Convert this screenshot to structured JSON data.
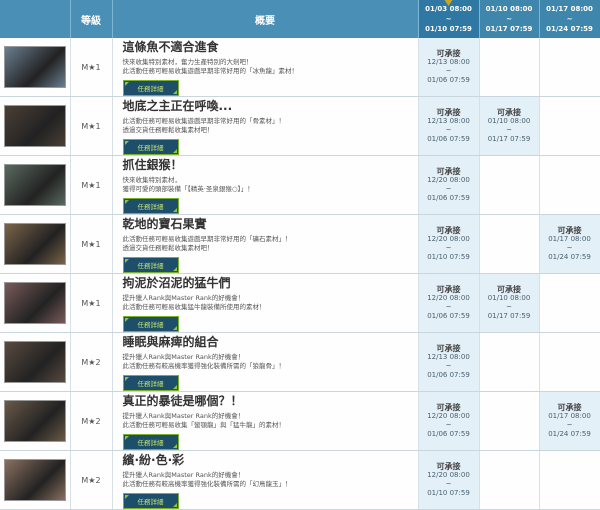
{
  "header": {
    "rank": "等級",
    "summary": "概要",
    "weeks": [
      {
        "start": "01/03 08:00",
        "sep": "~",
        "end": "01/10 07:59",
        "current": true
      },
      {
        "start": "01/10 08:00",
        "sep": "~",
        "end": "01/17 07:59"
      },
      {
        "start": "01/17 08:00",
        "sep": "~",
        "end": "01/24 07:59"
      }
    ]
  },
  "detail_label": "任務詳細",
  "available_label": "可承接",
  "quests": [
    {
      "thumb": "#6a7f90",
      "rank": "M★1",
      "title": "這條魚不適合進食",
      "desc": [
        "快來收集特別素材，奮力生產特別的大劍吧！",
        "此活動任務可輕易收集遊戲早期非常好用的「冰魚龍」素材！"
      ],
      "slots": [
        [
          "12/13 08:00",
          "01/06 07:59"
        ],
        null,
        null
      ]
    },
    {
      "thumb": "#4a3f35",
      "rank": "M★1",
      "title": "地底之主正在呼喚...",
      "desc": [
        "此活動任務可輕易收集遊戲早期非常好用的「骨素材」！",
        "透過交貨任務輕鬆收集素材吧！"
      ],
      "slots": [
        [
          "12/13 08:00",
          "01/06 07:59"
        ],
        [
          "01/10 08:00",
          "01/17 07:59"
        ],
        null
      ]
    },
    {
      "thumb": "#5a6a60",
      "rank": "M★1",
      "title": "抓住銀猴！",
      "desc": [
        "快來收集特別素材，",
        "獲得可愛的頭部裝備「【精英·圣泉銀猴○】」！"
      ],
      "slots": [
        [
          "12/20 08:00",
          "01/06 07:59"
        ],
        null,
        null
      ]
    },
    {
      "thumb": "#7a6448",
      "rank": "M★1",
      "title": "乾地的寶石果實",
      "desc": [
        "此活動任務可輕易收集遊戲早期非常好用的「礦石素材」！",
        "透過交貨任務輕鬆收集素材吧！"
      ],
      "slots": [
        [
          "12/20 08:00",
          "01/10 07:59"
        ],
        null,
        [
          "01/17 08:00",
          "01/24 07:59"
        ]
      ]
    },
    {
      "thumb": "#7a5a5a",
      "rank": "M★1",
      "title": "拘泥於沼泥的猛牛們",
      "desc": [
        "提升獵人Rank與Master Rank的好機會！",
        "此活動任務可輕易收集猛牛龍裝備所使用的素材！"
      ],
      "slots": [
        [
          "12/20 08:00",
          "01/06 07:59"
        ],
        [
          "01/10 08:00",
          "01/17 07:59"
        ],
        null
      ]
    },
    {
      "thumb": "#5a4a40",
      "rank": "M★2",
      "title": "睡眠與麻痺的組合",
      "desc": [
        "提升獵人Rank與Master Rank的好機會！",
        "此活動任務有較高機率獲得強化裝備所需的「狼龍骨」！"
      ],
      "slots": [
        [
          "12/13 08:00",
          "01/06 07:59"
        ],
        null,
        null
      ]
    },
    {
      "thumb": "#6a5a48",
      "rank": "M★2",
      "title": "真正的暴徒是哪個？！",
      "desc": [
        "提升獵人Rank與Master Rank的好機會！",
        "此活動任務可輕易收集「蠻顎龍」與「猛牛龍」的素材！"
      ],
      "slots": [
        [
          "12/20 08:00",
          "01/06 07:59"
        ],
        null,
        [
          "01/17 08:00",
          "01/24 07:59"
        ]
      ]
    },
    {
      "thumb": "#8a7060",
      "rank": "M★2",
      "title": "繽·紛·色·彩",
      "desc": [
        "提升獵人Rank與Master Rank的好機會！",
        "此活動任務有較高機率獲得強化裝備所需的「幻鳥龍玉」！"
      ],
      "slots": [
        [
          "12/20 08:00",
          "01/10 07:59"
        ],
        null,
        null
      ]
    }
  ]
}
